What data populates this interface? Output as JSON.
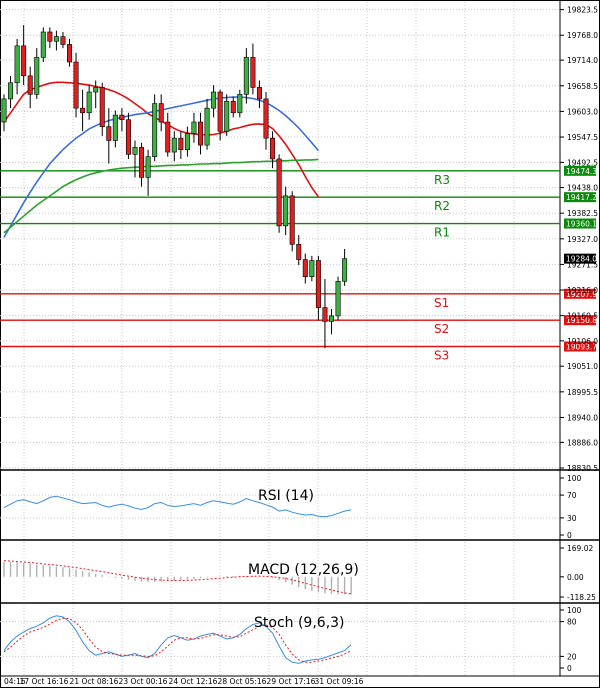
{
  "chart_data": {
    "type": "candlestick",
    "price_axis_ticks": [
      19823.5,
      19768.0,
      19714.0,
      19658.5,
      19603.0,
      19547.5,
      19492.5,
      19438.0,
      19382.5,
      19327.0,
      19271.5,
      19216.0,
      19160.5,
      19106.0,
      19051.0,
      18995.5,
      18940.0,
      18886.0,
      18830.5
    ],
    "price_axis_labels": [
      "19823.5",
      "19768.0",
      "19714.0",
      "19658.5",
      "19603.0",
      "19547.5",
      "19492.5",
      "19438.0",
      "19382.5",
      "19327.0",
      "19271.5",
      "19216.0",
      "19160.5",
      "19106.0",
      "19051.0",
      "18995.5",
      "18940.0",
      "18886.0",
      "18830.5"
    ],
    "ylim": [
      18830.5,
      19840.0
    ],
    "x_labels": [
      "04:16",
      "17 Oct 16:16",
      "21 Oct 08:16",
      "23 Oct 00:16",
      "24 Oct 12:16",
      "28 Oct 05:16",
      "29 Oct 17:16",
      "31 Oct 09:16"
    ],
    "current_price": {
      "value": 19284.0,
      "label": "19284.0"
    },
    "levels": [
      {
        "name": "R3",
        "value": 19474.3,
        "label": "19474.3",
        "color": "#0a8a0a"
      },
      {
        "name": "R2",
        "value": 19417.2,
        "label": "19417.2",
        "color": "#0a8a0a"
      },
      {
        "name": "R1",
        "value": 19360.1,
        "label": "19360.1",
        "color": "#0a8a0a"
      },
      {
        "name": "S1",
        "value": 19207.9,
        "label": "19207.9",
        "color": "#e01010"
      },
      {
        "name": "S2",
        "value": 19150.8,
        "label": "19150.8",
        "color": "#e01010"
      },
      {
        "name": "S3",
        "value": 19093.7,
        "label": "19093.7",
        "color": "#e01010"
      }
    ],
    "candles": [
      {
        "o": 19580,
        "h": 19640,
        "l": 19560,
        "c": 19630
      },
      {
        "o": 19630,
        "h": 19680,
        "l": 19610,
        "c": 19665
      },
      {
        "o": 19665,
        "h": 19760,
        "l": 19640,
        "c": 19745
      },
      {
        "o": 19745,
        "h": 19790,
        "l": 19660,
        "c": 19680
      },
      {
        "o": 19680,
        "h": 19700,
        "l": 19610,
        "c": 19640
      },
      {
        "o": 19640,
        "h": 19740,
        "l": 19630,
        "c": 19720
      },
      {
        "o": 19720,
        "h": 19785,
        "l": 19710,
        "c": 19775
      },
      {
        "o": 19775,
        "h": 19785,
        "l": 19740,
        "c": 19755
      },
      {
        "o": 19755,
        "h": 19778,
        "l": 19735,
        "c": 19765
      },
      {
        "o": 19765,
        "h": 19775,
        "l": 19740,
        "c": 19748
      },
      {
        "o": 19748,
        "h": 19760,
        "l": 19700,
        "c": 19710
      },
      {
        "o": 19710,
        "h": 19730,
        "l": 19590,
        "c": 19610
      },
      {
        "o": 19610,
        "h": 19650,
        "l": 19560,
        "c": 19600
      },
      {
        "o": 19600,
        "h": 19660,
        "l": 19585,
        "c": 19645
      },
      {
        "o": 19645,
        "h": 19670,
        "l": 19610,
        "c": 19655
      },
      {
        "o": 19655,
        "h": 19665,
        "l": 19550,
        "c": 19570
      },
      {
        "o": 19570,
        "h": 19610,
        "l": 19490,
        "c": 19540
      },
      {
        "o": 19540,
        "h": 19605,
        "l": 19525,
        "c": 19595
      },
      {
        "o": 19595,
        "h": 19610,
        "l": 19560,
        "c": 19585
      },
      {
        "o": 19585,
        "h": 19600,
        "l": 19500,
        "c": 19510
      },
      {
        "o": 19510,
        "h": 19540,
        "l": 19460,
        "c": 19525
      },
      {
        "o": 19525,
        "h": 19535,
        "l": 19440,
        "c": 19460
      },
      {
        "o": 19460,
        "h": 19520,
        "l": 19420,
        "c": 19505
      },
      {
        "o": 19505,
        "h": 19640,
        "l": 19495,
        "c": 19620
      },
      {
        "o": 19620,
        "h": 19640,
        "l": 19560,
        "c": 19580
      },
      {
        "o": 19580,
        "h": 19600,
        "l": 19505,
        "c": 19515
      },
      {
        "o": 19515,
        "h": 19560,
        "l": 19495,
        "c": 19545
      },
      {
        "o": 19545,
        "h": 19560,
        "l": 19500,
        "c": 19520
      },
      {
        "o": 19520,
        "h": 19570,
        "l": 19505,
        "c": 19555
      },
      {
        "o": 19555,
        "h": 19600,
        "l": 19535,
        "c": 19580
      },
      {
        "o": 19580,
        "h": 19600,
        "l": 19510,
        "c": 19530
      },
      {
        "o": 19530,
        "h": 19630,
        "l": 19520,
        "c": 19610
      },
      {
        "o": 19610,
        "h": 19660,
        "l": 19590,
        "c": 19645
      },
      {
        "o": 19645,
        "h": 19650,
        "l": 19540,
        "c": 19560
      },
      {
        "o": 19560,
        "h": 19640,
        "l": 19550,
        "c": 19625
      },
      {
        "o": 19625,
        "h": 19635,
        "l": 19590,
        "c": 19600
      },
      {
        "o": 19600,
        "h": 19650,
        "l": 19590,
        "c": 19640
      },
      {
        "o": 19640,
        "h": 19740,
        "l": 19620,
        "c": 19720
      },
      {
        "o": 19720,
        "h": 19750,
        "l": 19640,
        "c": 19655
      },
      {
        "o": 19655,
        "h": 19670,
        "l": 19610,
        "c": 19630
      },
      {
        "o": 19630,
        "h": 19645,
        "l": 19520,
        "c": 19545
      },
      {
        "o": 19545,
        "h": 19560,
        "l": 19480,
        "c": 19500
      },
      {
        "o": 19500,
        "h": 19510,
        "l": 19340,
        "c": 19355
      },
      {
        "o": 19355,
        "h": 19440,
        "l": 19335,
        "c": 19420
      },
      {
        "o": 19420,
        "h": 19430,
        "l": 19300,
        "c": 19315
      },
      {
        "o": 19315,
        "h": 19335,
        "l": 19270,
        "c": 19282
      },
      {
        "o": 19282,
        "h": 19295,
        "l": 19230,
        "c": 19245
      },
      {
        "o": 19245,
        "h": 19290,
        "l": 19235,
        "c": 19280
      },
      {
        "o": 19280,
        "h": 19290,
        "l": 19150,
        "c": 19178
      },
      {
        "o": 19178,
        "h": 19240,
        "l": 19090,
        "c": 19148
      },
      {
        "o": 19148,
        "h": 19175,
        "l": 19120,
        "c": 19160
      },
      {
        "o": 19160,
        "h": 19245,
        "l": 19150,
        "c": 19235
      },
      {
        "o": 19235,
        "h": 19305,
        "l": 19225,
        "c": 19284
      }
    ],
    "ma_series": [
      {
        "color": "#e01010",
        "start": 0,
        "values": [
          19580,
          19600,
          19620,
          19640,
          19650,
          19655,
          19660,
          19664,
          19666,
          19666,
          19665,
          19664,
          19662,
          19660,
          19657,
          19654,
          19650,
          19645,
          19638,
          19630,
          19620,
          19610,
          19598,
          19590,
          19582,
          19574,
          19566,
          19560,
          19556,
          19554,
          19553,
          19552,
          19553,
          19556,
          19560,
          19565,
          19568,
          19572,
          19575,
          19576,
          19574,
          19566,
          19550,
          19532,
          19510,
          19488,
          19462,
          19438,
          19418
        ]
      },
      {
        "color": "#3a6ee0",
        "start": 0,
        "values": [
          19330,
          19355,
          19380,
          19405,
          19428,
          19450,
          19470,
          19490,
          19505,
          19520,
          19533,
          19545,
          19555,
          19565,
          19572,
          19578,
          19583,
          19587,
          19590,
          19593,
          19596,
          19598,
          19600,
          19603,
          19606,
          19609,
          19612,
          19615,
          19618,
          19621,
          19624,
          19627,
          19630,
          19632,
          19633,
          19634,
          19634,
          19633,
          19631,
          19627,
          19622,
          19614,
          19605,
          19594,
          19581,
          19567,
          19551,
          19535,
          19518
        ]
      },
      {
        "color": "#2ca02c",
        "start": 0,
        "values": [
          19340,
          19352,
          19364,
          19376,
          19388,
          19400,
          19410,
          19420,
          19430,
          19440,
          19448,
          19455,
          19461,
          19466,
          19470,
          19473,
          19476,
          19478,
          19480,
          19481,
          19482,
          19483,
          19484,
          19484,
          19485,
          19486,
          19486,
          19487,
          19487,
          19488,
          19489,
          19489,
          19490,
          19490,
          19491,
          19492,
          19492,
          19493,
          19494,
          19494,
          19495,
          19495,
          19496,
          19496,
          19497,
          19497,
          19498,
          19498,
          19499
        ]
      }
    ],
    "rsi": {
      "label": "RSI (14)",
      "ticks": [
        "100",
        "70",
        "30",
        "0"
      ],
      "tick_values": [
        100,
        70,
        30,
        0
      ],
      "values": [
        48,
        54,
        60,
        62,
        58,
        55,
        60,
        66,
        68,
        65,
        62,
        58,
        55,
        56,
        57,
        52,
        49,
        52,
        54,
        51,
        47,
        45,
        48,
        55,
        57,
        52,
        50,
        51,
        53,
        55,
        52,
        57,
        60,
        58,
        56,
        54,
        58,
        64,
        60,
        57,
        53,
        49,
        42,
        44,
        40,
        37,
        35,
        36,
        33,
        32,
        34,
        38,
        42,
        44
      ]
    },
    "macd": {
      "label": "MACD (12,26,9)",
      "ticks": [
        "169.02",
        "0.00",
        "-118.25"
      ],
      "tick_values": [
        169.02,
        0,
        -118.25
      ],
      "hist": [
        90,
        88,
        85,
        82,
        78,
        72,
        68,
        64,
        60,
        56,
        50,
        42,
        34,
        26,
        18,
        10,
        2,
        -6,
        -12,
        -18,
        -24,
        -28,
        -30,
        -30,
        -28,
        -26,
        -24,
        -20,
        -16,
        -12,
        -8,
        -4,
        0,
        2,
        4,
        5,
        6,
        6,
        5,
        4,
        2,
        -6,
        -18,
        -32,
        -46,
        -60,
        -72,
        -82,
        -90,
        -96,
        -100,
        -102,
        -104,
        -104
      ],
      "signal": [
        95,
        92,
        90,
        87,
        84,
        80,
        76,
        72,
        68,
        64,
        59,
        54,
        48,
        42,
        36,
        30,
        24,
        17,
        10,
        4,
        -2,
        -8,
        -12,
        -16,
        -19,
        -21,
        -22,
        -22,
        -21,
        -19,
        -17,
        -14,
        -11,
        -8,
        -5,
        -2,
        0,
        2,
        3,
        4,
        3,
        0,
        -4,
        -10,
        -18,
        -28,
        -38,
        -48,
        -58,
        -68,
        -77,
        -86,
        -94,
        -100
      ]
    },
    "stoch": {
      "label": "Stoch (9,6,3)",
      "ticks": [
        "100",
        "80",
        "20",
        "0"
      ],
      "tick_values": [
        100,
        80,
        20,
        0
      ],
      "k": [
        30,
        45,
        55,
        62,
        68,
        72,
        78,
        86,
        90,
        88,
        80,
        65,
        45,
        30,
        22,
        25,
        28,
        24,
        20,
        22,
        25,
        20,
        18,
        25,
        40,
        52,
        56,
        52,
        48,
        50,
        55,
        58,
        60,
        55,
        50,
        52,
        58,
        68,
        75,
        78,
        72,
        60,
        38,
        18,
        10,
        8,
        12,
        14,
        15,
        18,
        22,
        26,
        30,
        40
      ],
      "d": [
        28,
        36,
        46,
        55,
        62,
        66,
        70,
        76,
        82,
        86,
        85,
        78,
        66,
        50,
        36,
        28,
        25,
        24,
        22,
        22,
        22,
        21,
        20,
        21,
        28,
        38,
        48,
        52,
        52,
        50,
        51,
        54,
        57,
        57,
        55,
        53,
        54,
        60,
        66,
        72,
        74,
        70,
        58,
        40,
        24,
        14,
        10,
        10,
        12,
        14,
        17,
        20,
        24,
        30
      ]
    }
  }
}
